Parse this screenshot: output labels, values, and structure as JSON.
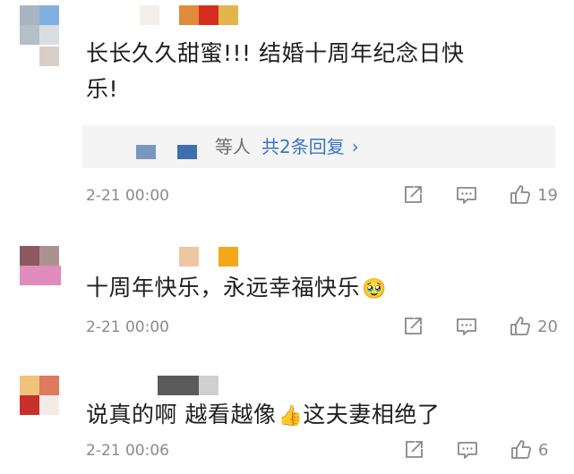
{
  "comments": [
    {
      "text_line1": "长长久久甜蜜!!! 结婚十周年纪念日快",
      "text_line2": "乐!",
      "reply": {
        "prefix": "等人",
        "count_label": "共2条回复",
        "chevron": "›"
      },
      "time": "2-21 00:00",
      "likes": "19"
    },
    {
      "text": "十周年快乐，永远幸福快乐",
      "emoji": "🥹",
      "time": "2-21 00:00",
      "likes": "20"
    },
    {
      "text_part1": "说真的啊 越看越像",
      "emoji": "👍",
      "text_part2": "这夫妻相绝了",
      "time": "2-21 00:06",
      "likes": "6"
    }
  ],
  "icons": [
    "share-icon",
    "comment-icon",
    "like-icon"
  ],
  "colors": {
    "text": "#1f1f1f",
    "meta": "#8a8a8a",
    "link": "#3a74c4",
    "reply_bg": "#f4f4f4"
  }
}
